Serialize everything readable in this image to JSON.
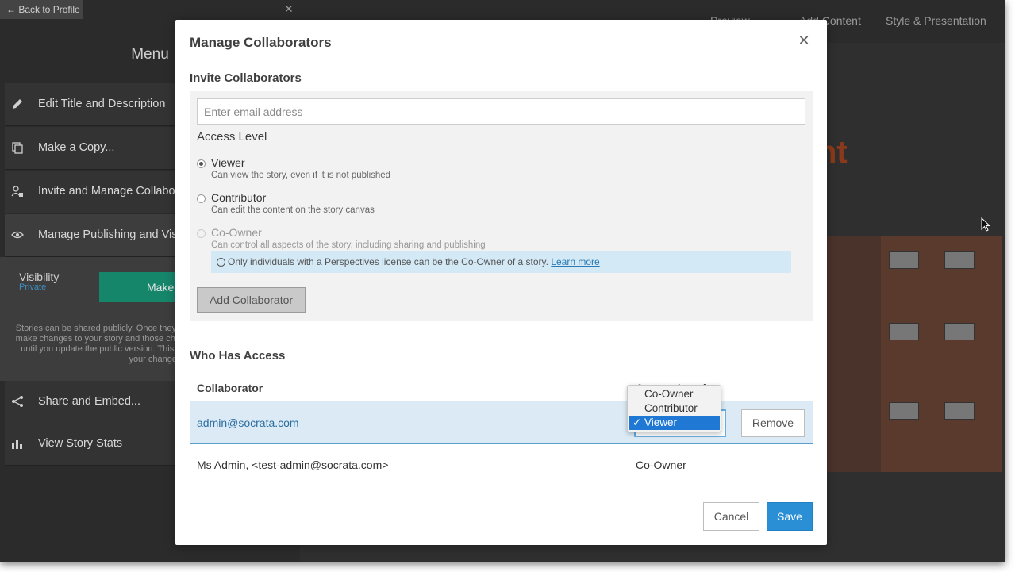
{
  "sidebar": {
    "back_label": "← Back to Profile",
    "close_glyph": "✕",
    "menu_title": "Menu",
    "items": [
      {
        "label": "Edit Title and Description",
        "icon": "pencil-icon"
      },
      {
        "label": "Make a Copy...",
        "icon": "copy-icon"
      },
      {
        "label": "Invite and Manage Collaborators",
        "icon": "user-lock-icon"
      },
      {
        "label": "Manage Publishing and Visibility",
        "icon": "eye-icon"
      },
      {
        "label": "Share and Embed...",
        "icon": "share-icon"
      },
      {
        "label": "View Story Stats",
        "icon": "bar-chart-icon"
      }
    ],
    "visibility": {
      "label": "Visibility",
      "status": "Private",
      "button_label": "Make Story Public",
      "description": "Stories can be shared publicly. Once they are public, you can continue to make changes to your story and those changes will be visible only to you until you update the public version. This lets you decide when to share your changes."
    }
  },
  "topbar": {
    "preview": "Preview",
    "add_content": "Add Content",
    "style": "Style & Presentation"
  },
  "canvas": {
    "heading_fragment": "nt"
  },
  "modal": {
    "title": "Manage Collaborators",
    "close_glyph": "✕",
    "invite": {
      "heading": "Invite Collaborators",
      "email_placeholder": "Enter email address",
      "email_value": "",
      "access_heading": "Access Level",
      "options": [
        {
          "title": "Viewer",
          "desc": "Can view the story, even if it is not published",
          "checked": true,
          "disabled": false
        },
        {
          "title": "Contributor",
          "desc": "Can edit the content on the story canvas",
          "checked": false,
          "disabled": false
        },
        {
          "title": "Co-Owner",
          "desc": "Can control all aspects of the story, including sharing and publishing",
          "checked": false,
          "disabled": true
        }
      ],
      "info_text": "Only individuals with a Perspectives license can be the Co-Owner of a story.",
      "info_link": "Learn more",
      "add_button": "Add Collaborator"
    },
    "who": {
      "heading": "Who Has Access",
      "columns": [
        "Collaborator",
        "Access Level"
      ],
      "rows": [
        {
          "collaborator": "admin@socrata.com",
          "access": "Viewer",
          "remove_label": "Remove"
        },
        {
          "collaborator": "Ms Admin, <test-admin@socrata.com>",
          "access": "Co-Owner"
        }
      ],
      "dropdown_options": [
        "Co-Owner",
        "Contributor",
        "Viewer"
      ],
      "dropdown_selected": "Viewer",
      "check_glyph": "✓"
    },
    "cancel_label": "Cancel",
    "save_label": "Save"
  },
  "colors": {
    "primary": "#2b8fd6",
    "make_public": "#16866b",
    "status_link": "#3e8fc1",
    "highlight_row": "#dbeaf5",
    "info_bg": "#d4e9f6"
  }
}
